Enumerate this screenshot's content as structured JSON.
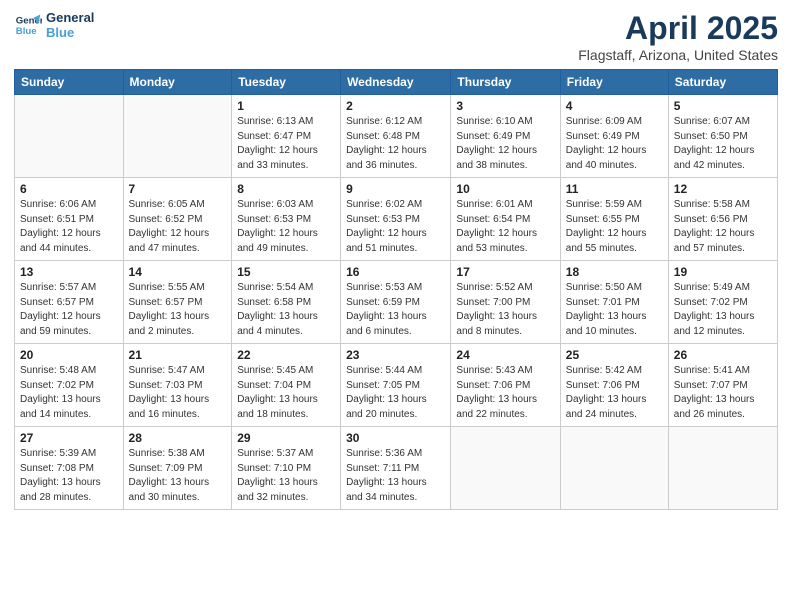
{
  "logo": {
    "line1": "General",
    "line2": "Blue"
  },
  "title": "April 2025",
  "subtitle": "Flagstaff, Arizona, United States",
  "days_header": [
    "Sunday",
    "Monday",
    "Tuesday",
    "Wednesday",
    "Thursday",
    "Friday",
    "Saturday"
  ],
  "weeks": [
    [
      {
        "num": "",
        "info": ""
      },
      {
        "num": "",
        "info": ""
      },
      {
        "num": "1",
        "info": "Sunrise: 6:13 AM\nSunset: 6:47 PM\nDaylight: 12 hours\nand 33 minutes."
      },
      {
        "num": "2",
        "info": "Sunrise: 6:12 AM\nSunset: 6:48 PM\nDaylight: 12 hours\nand 36 minutes."
      },
      {
        "num": "3",
        "info": "Sunrise: 6:10 AM\nSunset: 6:49 PM\nDaylight: 12 hours\nand 38 minutes."
      },
      {
        "num": "4",
        "info": "Sunrise: 6:09 AM\nSunset: 6:49 PM\nDaylight: 12 hours\nand 40 minutes."
      },
      {
        "num": "5",
        "info": "Sunrise: 6:07 AM\nSunset: 6:50 PM\nDaylight: 12 hours\nand 42 minutes."
      }
    ],
    [
      {
        "num": "6",
        "info": "Sunrise: 6:06 AM\nSunset: 6:51 PM\nDaylight: 12 hours\nand 44 minutes."
      },
      {
        "num": "7",
        "info": "Sunrise: 6:05 AM\nSunset: 6:52 PM\nDaylight: 12 hours\nand 47 minutes."
      },
      {
        "num": "8",
        "info": "Sunrise: 6:03 AM\nSunset: 6:53 PM\nDaylight: 12 hours\nand 49 minutes."
      },
      {
        "num": "9",
        "info": "Sunrise: 6:02 AM\nSunset: 6:53 PM\nDaylight: 12 hours\nand 51 minutes."
      },
      {
        "num": "10",
        "info": "Sunrise: 6:01 AM\nSunset: 6:54 PM\nDaylight: 12 hours\nand 53 minutes."
      },
      {
        "num": "11",
        "info": "Sunrise: 5:59 AM\nSunset: 6:55 PM\nDaylight: 12 hours\nand 55 minutes."
      },
      {
        "num": "12",
        "info": "Sunrise: 5:58 AM\nSunset: 6:56 PM\nDaylight: 12 hours\nand 57 minutes."
      }
    ],
    [
      {
        "num": "13",
        "info": "Sunrise: 5:57 AM\nSunset: 6:57 PM\nDaylight: 12 hours\nand 59 minutes."
      },
      {
        "num": "14",
        "info": "Sunrise: 5:55 AM\nSunset: 6:57 PM\nDaylight: 13 hours\nand 2 minutes."
      },
      {
        "num": "15",
        "info": "Sunrise: 5:54 AM\nSunset: 6:58 PM\nDaylight: 13 hours\nand 4 minutes."
      },
      {
        "num": "16",
        "info": "Sunrise: 5:53 AM\nSunset: 6:59 PM\nDaylight: 13 hours\nand 6 minutes."
      },
      {
        "num": "17",
        "info": "Sunrise: 5:52 AM\nSunset: 7:00 PM\nDaylight: 13 hours\nand 8 minutes."
      },
      {
        "num": "18",
        "info": "Sunrise: 5:50 AM\nSunset: 7:01 PM\nDaylight: 13 hours\nand 10 minutes."
      },
      {
        "num": "19",
        "info": "Sunrise: 5:49 AM\nSunset: 7:02 PM\nDaylight: 13 hours\nand 12 minutes."
      }
    ],
    [
      {
        "num": "20",
        "info": "Sunrise: 5:48 AM\nSunset: 7:02 PM\nDaylight: 13 hours\nand 14 minutes."
      },
      {
        "num": "21",
        "info": "Sunrise: 5:47 AM\nSunset: 7:03 PM\nDaylight: 13 hours\nand 16 minutes."
      },
      {
        "num": "22",
        "info": "Sunrise: 5:45 AM\nSunset: 7:04 PM\nDaylight: 13 hours\nand 18 minutes."
      },
      {
        "num": "23",
        "info": "Sunrise: 5:44 AM\nSunset: 7:05 PM\nDaylight: 13 hours\nand 20 minutes."
      },
      {
        "num": "24",
        "info": "Sunrise: 5:43 AM\nSunset: 7:06 PM\nDaylight: 13 hours\nand 22 minutes."
      },
      {
        "num": "25",
        "info": "Sunrise: 5:42 AM\nSunset: 7:06 PM\nDaylight: 13 hours\nand 24 minutes."
      },
      {
        "num": "26",
        "info": "Sunrise: 5:41 AM\nSunset: 7:07 PM\nDaylight: 13 hours\nand 26 minutes."
      }
    ],
    [
      {
        "num": "27",
        "info": "Sunrise: 5:39 AM\nSunset: 7:08 PM\nDaylight: 13 hours\nand 28 minutes."
      },
      {
        "num": "28",
        "info": "Sunrise: 5:38 AM\nSunset: 7:09 PM\nDaylight: 13 hours\nand 30 minutes."
      },
      {
        "num": "29",
        "info": "Sunrise: 5:37 AM\nSunset: 7:10 PM\nDaylight: 13 hours\nand 32 minutes."
      },
      {
        "num": "30",
        "info": "Sunrise: 5:36 AM\nSunset: 7:11 PM\nDaylight: 13 hours\nand 34 minutes."
      },
      {
        "num": "",
        "info": ""
      },
      {
        "num": "",
        "info": ""
      },
      {
        "num": "",
        "info": ""
      }
    ]
  ]
}
